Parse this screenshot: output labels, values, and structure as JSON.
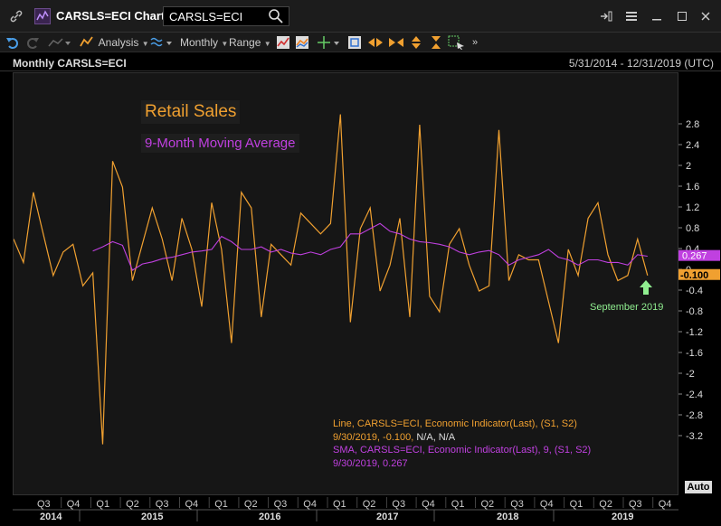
{
  "window": {
    "title": "CARSLS=ECI Chart",
    "ric_input_value": "CARSLS=ECI"
  },
  "toolbar": {
    "analysis_label": "Analysis",
    "interval_label": "Monthly",
    "range_label": "Range"
  },
  "chart_header": {
    "left_title": "Monthly CARSLS=ECI",
    "date_range": "5/31/2014 - 12/31/2019 (UTC)"
  },
  "annotations": {
    "retail_sales": "Retail Sales",
    "moving_average": "9-Month Moving Average",
    "september": "September 2019"
  },
  "legend": {
    "line1": "Line, CARSLS=ECI, Economic Indicator(Last), (S1, S2)",
    "line2": "9/30/2019, -0.100,",
    "line2_na": "N/A, N/A",
    "sma1": "SMA, CARSLS=ECI, Economic Indicator(Last),  9, (S1, S2)",
    "sma2": "9/30/2019, 0.267"
  },
  "axis": {
    "auto_label": "Auto",
    "last_sma_badge": "0.267",
    "last_line_badge": "-0.100"
  },
  "colors": {
    "line": "#f0a030",
    "sma": "#c040e0",
    "annotation_green": "#90ee90"
  },
  "icons": [
    "link-icon",
    "chart-logo-icon",
    "search-icon",
    "share-icon",
    "menu-icon",
    "minimize-icon",
    "maximize-icon",
    "close-icon",
    "undo-icon",
    "redo-icon"
  ],
  "chart_data": {
    "type": "line",
    "ylim": [
      -3.5,
      3.0
    ],
    "yticks": [
      2.8,
      2.4,
      2.0,
      1.6,
      1.2,
      0.8,
      0.4,
      0,
      -0.4,
      -0.8,
      -1.2,
      -1.6,
      -2.0,
      -2.4,
      -2.8,
      -3.2
    ],
    "ytick_labels": [
      "2.8",
      "2.4",
      "2",
      "1.6",
      "1.2",
      "0.8",
      "0.4",
      "0",
      "-0.4",
      "-0.8",
      "-1.2",
      "-1.6",
      "-2",
      "-2.4",
      "-2.8",
      "-3.2"
    ],
    "quarter_labels": [
      "Q3",
      "Q4",
      "Q1",
      "Q2",
      "Q3",
      "Q4",
      "Q1",
      "Q2",
      "Q3",
      "Q4",
      "Q1",
      "Q2",
      "Q3",
      "Q4",
      "Q1",
      "Q2",
      "Q3",
      "Q4",
      "Q1",
      "Q2",
      "Q3",
      "Q4"
    ],
    "year_labels": [
      "2014",
      "2015",
      "2016",
      "2017",
      "2018",
      "2019"
    ],
    "x": [
      "2014-05",
      "2014-06",
      "2014-07",
      "2014-08",
      "2014-09",
      "2014-10",
      "2014-11",
      "2014-12",
      "2015-01",
      "2015-02",
      "2015-03",
      "2015-04",
      "2015-05",
      "2015-06",
      "2015-07",
      "2015-08",
      "2015-09",
      "2015-10",
      "2015-11",
      "2015-12",
      "2016-01",
      "2016-02",
      "2016-03",
      "2016-04",
      "2016-05",
      "2016-06",
      "2016-07",
      "2016-08",
      "2016-09",
      "2016-10",
      "2016-11",
      "2016-12",
      "2017-01",
      "2017-02",
      "2017-03",
      "2017-04",
      "2017-05",
      "2017-06",
      "2017-07",
      "2017-08",
      "2017-09",
      "2017-10",
      "2017-11",
      "2017-12",
      "2018-01",
      "2018-02",
      "2018-03",
      "2018-04",
      "2018-05",
      "2018-06",
      "2018-07",
      "2018-08",
      "2018-09",
      "2018-10",
      "2018-11",
      "2018-12",
      "2019-01",
      "2019-02",
      "2019-03",
      "2019-04",
      "2019-05",
      "2019-06",
      "2019-07",
      "2019-08",
      "2019-09"
    ],
    "series": [
      {
        "name": "Line",
        "values": [
          0.6,
          0.15,
          1.5,
          0.7,
          -0.1,
          0.35,
          0.5,
          -0.3,
          -0.05,
          -3.35,
          2.1,
          1.6,
          -0.2,
          0.5,
          1.2,
          0.6,
          -0.2,
          1.0,
          0.4,
          -0.7,
          1.3,
          0.4,
          -1.4,
          1.5,
          1.2,
          -0.9,
          0.5,
          0.3,
          0.1,
          1.1,
          0.9,
          0.7,
          0.9,
          3.0,
          -1.0,
          0.8,
          1.2,
          -0.4,
          0.1,
          1.0,
          -0.9,
          2.8,
          -0.5,
          -0.8,
          0.5,
          0.8,
          0.1,
          -0.4,
          -0.3,
          2.7,
          -0.2,
          0.3,
          0.2,
          0.2,
          -0.6,
          -1.4,
          0.4,
          -0.1,
          1.0,
          1.3,
          0.3,
          -0.2,
          -0.1,
          0.6,
          -0.1
        ],
        "color": "#f0a030"
      },
      {
        "name": "SMA 9",
        "values": [
          null,
          null,
          null,
          null,
          null,
          null,
          null,
          null,
          0.37,
          0.45,
          0.55,
          0.48,
          0.0,
          0.12,
          0.16,
          0.22,
          0.25,
          0.3,
          0.35,
          0.37,
          0.4,
          0.65,
          0.55,
          0.4,
          0.4,
          0.45,
          0.35,
          0.4,
          0.33,
          0.3,
          0.35,
          0.3,
          0.4,
          0.45,
          0.7,
          0.7,
          0.8,
          0.9,
          0.75,
          0.7,
          0.6,
          0.55,
          0.53,
          0.5,
          0.45,
          0.35,
          0.3,
          0.35,
          0.38,
          0.3,
          0.1,
          0.2,
          0.25,
          0.3,
          0.4,
          0.25,
          0.2,
          0.1,
          0.2,
          0.2,
          0.15,
          0.15,
          0.1,
          0.3,
          0.27
        ],
        "color": "#c040e0"
      }
    ],
    "last_values": {
      "line": -0.1,
      "sma": 0.267
    }
  }
}
